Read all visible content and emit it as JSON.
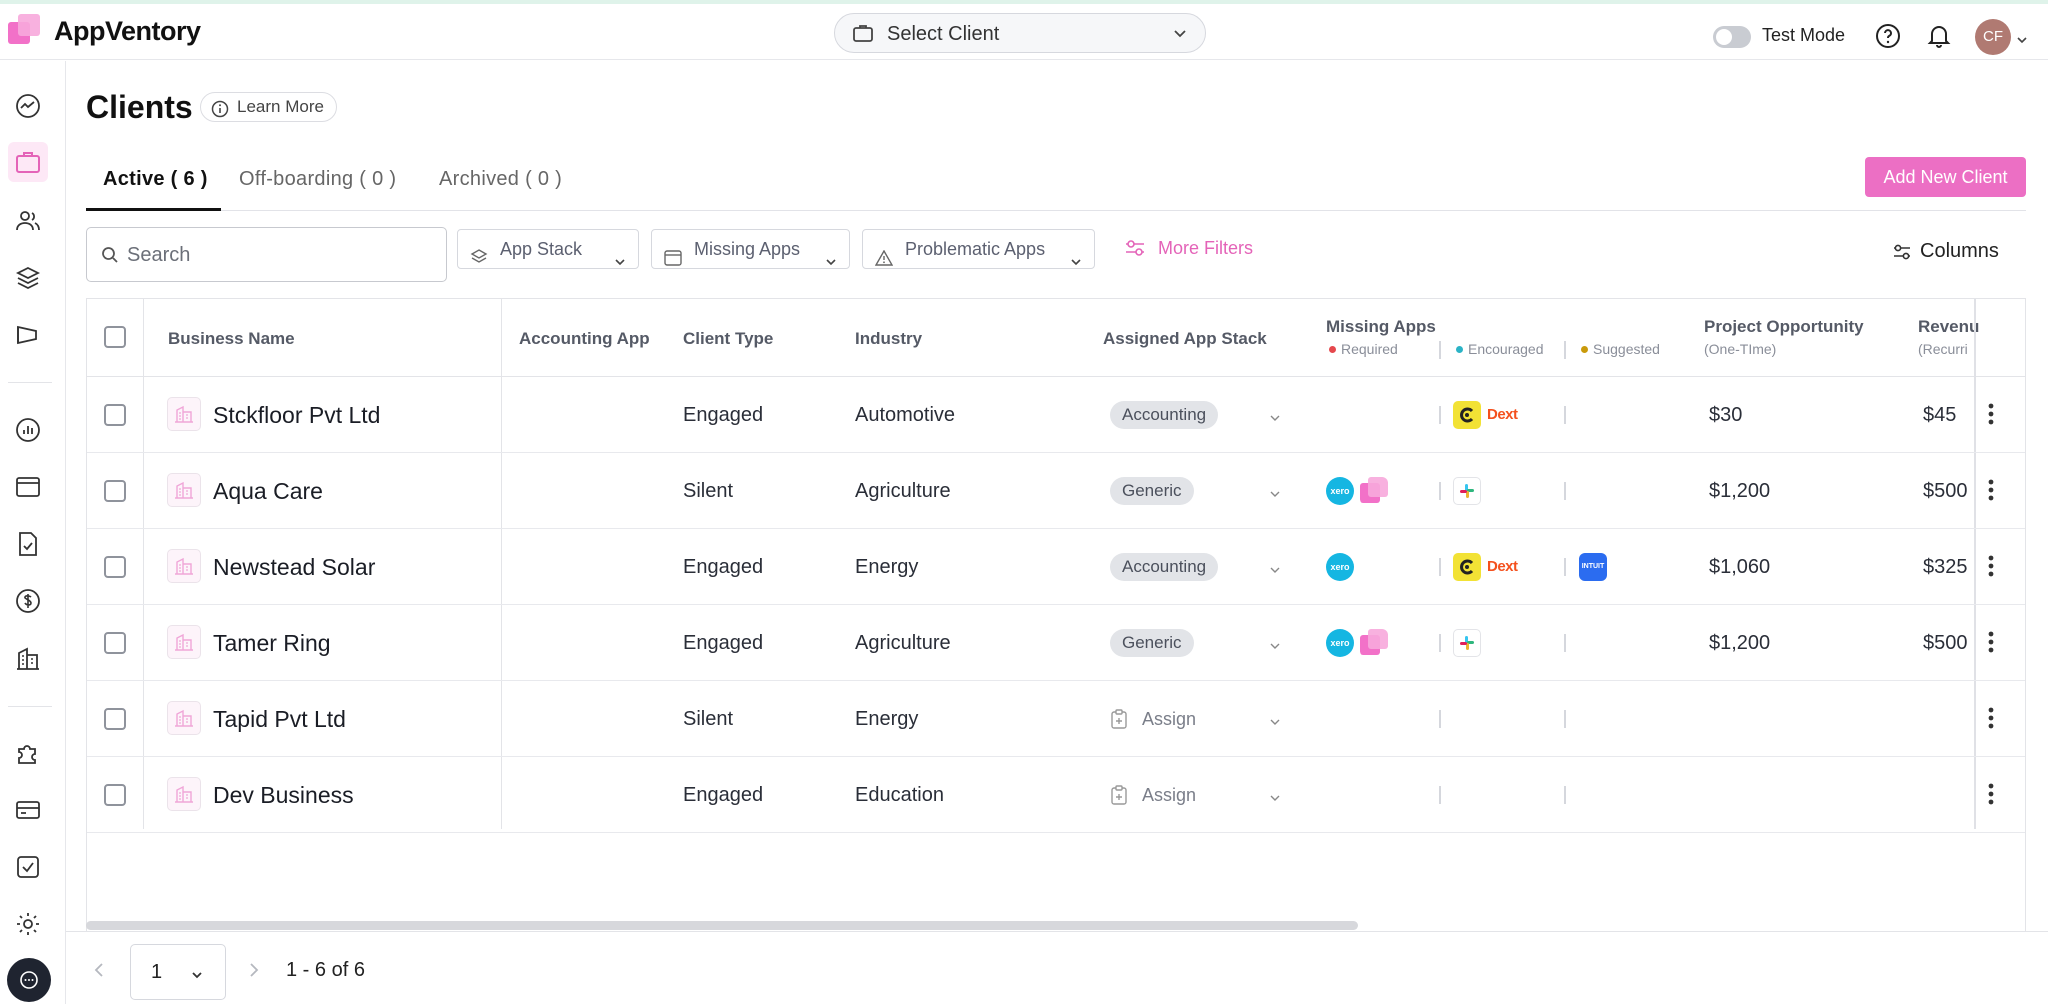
{
  "app": {
    "brand": "AppVentory"
  },
  "header": {
    "client_select_label": "Select Client",
    "test_mode_label": "Test Mode",
    "test_mode_on": false,
    "avatar_initials": "CF"
  },
  "sidebar": {
    "items": [
      {
        "icon": "dashboard-icon"
      },
      {
        "icon": "briefcase-icon",
        "active": true
      },
      {
        "icon": "users-icon"
      },
      {
        "icon": "layers-icon"
      },
      {
        "icon": "campaign-icon"
      },
      {
        "icon": "chart-icon"
      },
      {
        "icon": "window-icon"
      },
      {
        "icon": "document-check-icon"
      },
      {
        "icon": "dollar-icon"
      },
      {
        "icon": "building-icon"
      },
      {
        "icon": "puzzle-icon"
      },
      {
        "icon": "credit-card-icon"
      },
      {
        "icon": "checkbox-icon"
      },
      {
        "icon": "settings-icon"
      }
    ]
  },
  "page": {
    "title": "Clients",
    "learn_more": "Learn More",
    "tabs": [
      {
        "label": "Active ( 6 )",
        "active": true
      },
      {
        "label": "Off-boarding ( 0 )",
        "active": false
      },
      {
        "label": "Archived ( 0 )",
        "active": false
      }
    ],
    "add_button": "Add New Client"
  },
  "filters": {
    "search_placeholder": "Search",
    "app_stack": "App Stack",
    "missing_apps": "Missing Apps",
    "problematic_apps": "Problematic Apps",
    "more_filters": "More Filters",
    "columns": "Columns"
  },
  "table": {
    "headers": {
      "business_name": "Business Name",
      "accounting_app": "Accounting App",
      "client_type": "Client Type",
      "industry": "Industry",
      "assigned_app_stack": "Assigned App Stack",
      "missing_apps": "Missing Apps",
      "missing_required": "Required",
      "missing_encouraged": "Encouraged",
      "missing_suggested": "Suggested",
      "project_opportunity": "Project Opportunity",
      "project_opportunity_sub": "(One-TIme)",
      "revenue": "Revenu",
      "revenue_sub": "(Recurri"
    },
    "legend_colors": {
      "required": "#e5484d",
      "encouraged": "#2bb3c6",
      "suggested": "#c99a0b"
    },
    "rows": [
      {
        "name": "Stckfloor Pvt Ltd",
        "client_type": "Engaged",
        "industry": "Automotive",
        "app_stack": "Accounting",
        "required": [],
        "encouraged": [
          "dext-yellow-icon",
          "dext-icon"
        ],
        "suggested": [],
        "project": "$30",
        "revenue": "$45"
      },
      {
        "name": "Aqua Care",
        "client_type": "Silent",
        "industry": "Agriculture",
        "app_stack": "Generic",
        "required": [
          "xero-icon",
          "appventory-icon"
        ],
        "encouraged": [
          "slack-icon"
        ],
        "suggested": [],
        "project": "$1,200",
        "revenue": "$500"
      },
      {
        "name": "Newstead Solar",
        "client_type": "Engaged",
        "industry": "Energy",
        "app_stack": "Accounting",
        "required": [
          "xero-icon"
        ],
        "encouraged": [
          "dext-yellow-icon",
          "dext-icon"
        ],
        "suggested": [
          "intuit-icon"
        ],
        "project": "$1,060",
        "revenue": "$325"
      },
      {
        "name": "Tamer Ring",
        "client_type": "Engaged",
        "industry": "Agriculture",
        "app_stack": "Generic",
        "required": [
          "xero-icon",
          "appventory-icon"
        ],
        "encouraged": [
          "slack-icon"
        ],
        "suggested": [],
        "project": "$1,200",
        "revenue": "$500"
      },
      {
        "name": "Tapid Pvt Ltd",
        "client_type": "Silent",
        "industry": "Energy",
        "app_stack": "Assign",
        "required": [],
        "encouraged": [],
        "suggested": [],
        "project": "",
        "revenue": ""
      },
      {
        "name": "Dev Business",
        "client_type": "Engaged",
        "industry": "Education",
        "app_stack": "Assign",
        "required": [],
        "encouraged": [],
        "suggested": [],
        "project": "",
        "revenue": ""
      }
    ],
    "icon_labels": {
      "xero": "xero",
      "dext": "Dext",
      "intuit": "INTUIT"
    }
  },
  "pagination": {
    "page": "1",
    "summary": "1 - 6 of 6"
  },
  "colors": {
    "accent": "#ec6fc4",
    "accent_text": "#e463b8"
  }
}
